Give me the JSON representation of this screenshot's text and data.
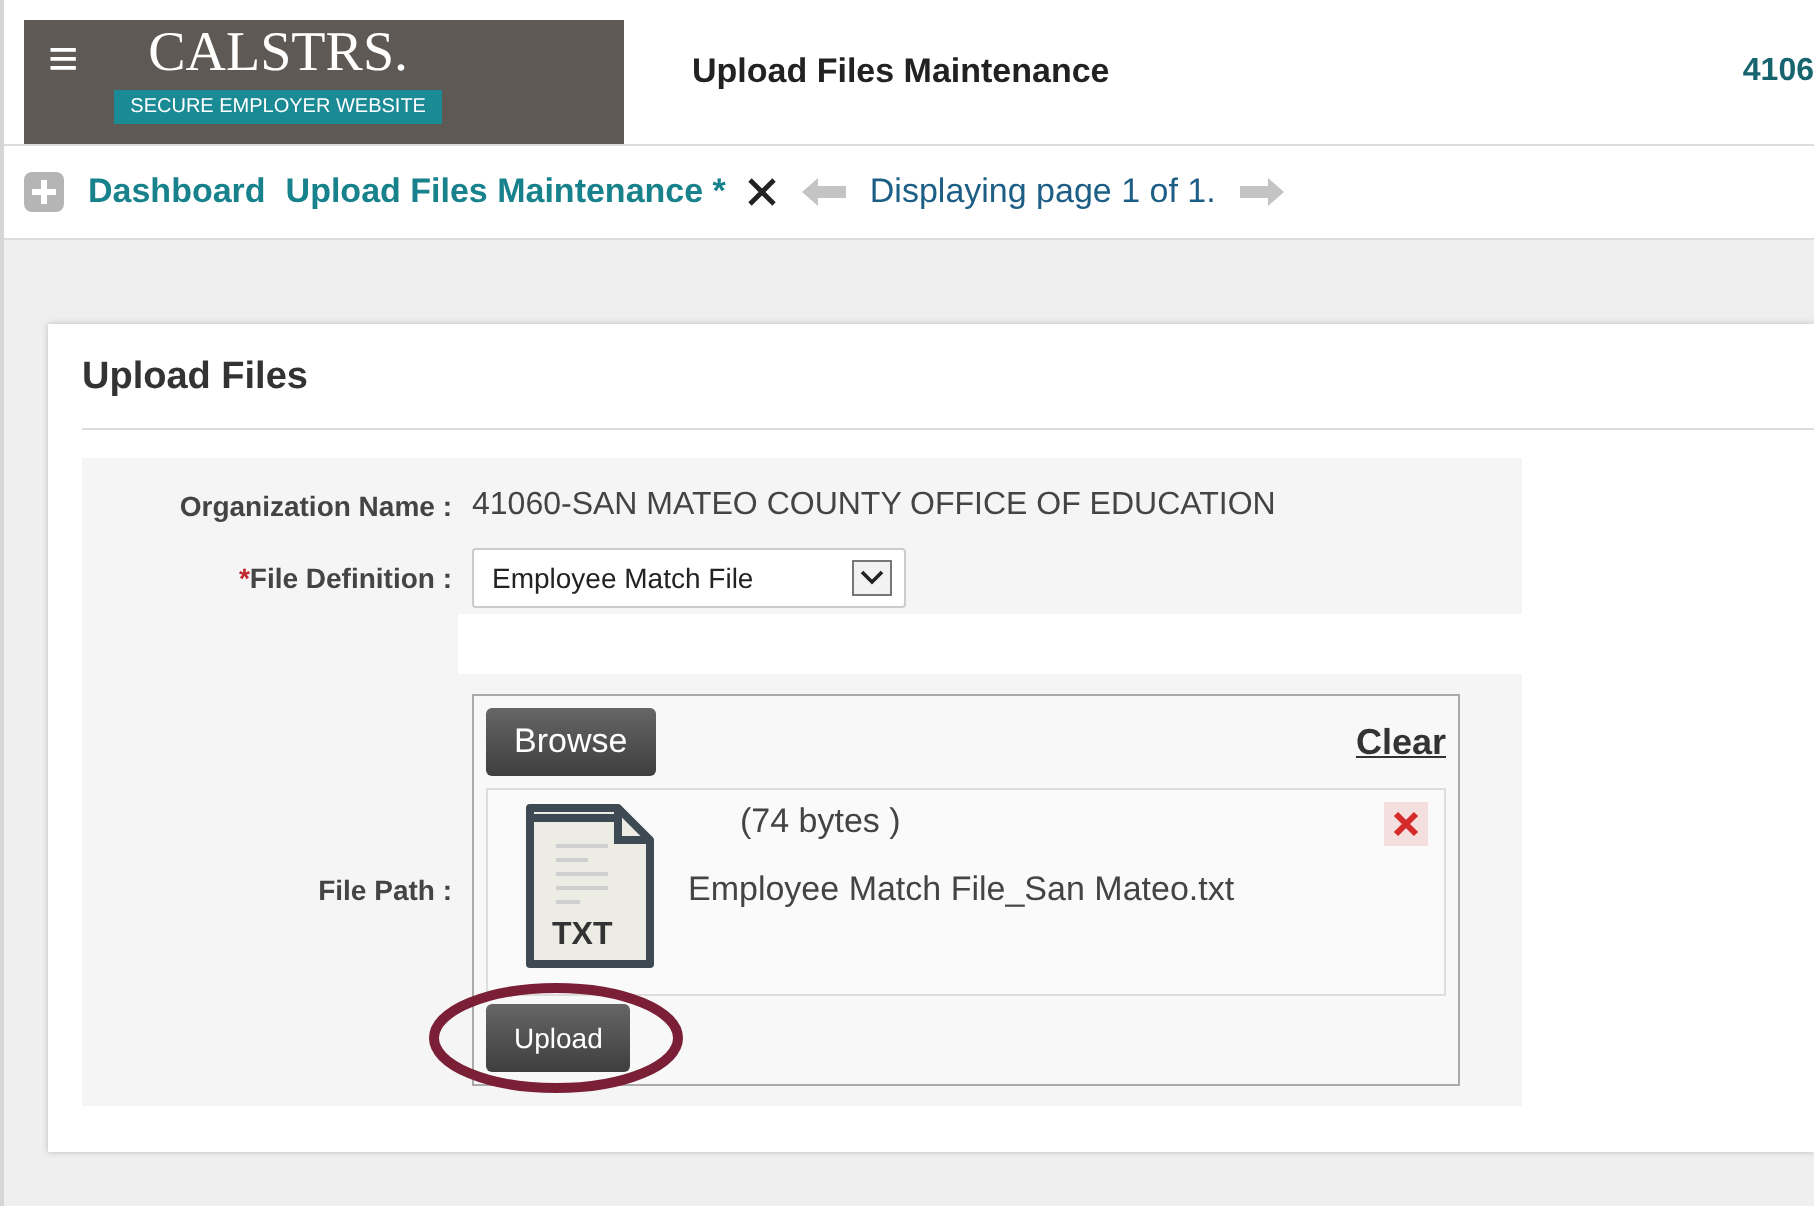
{
  "header": {
    "menu_glyph": "≡",
    "logo_text": "CALSTRS.",
    "logo_tagline": "SECURE EMPLOYER WEBSITE",
    "title": "Upload Files Maintenance",
    "org_code": "4106"
  },
  "breadcrumb": {
    "items": [
      {
        "label": "Dashboard"
      },
      {
        "label": "Upload Files Maintenance *"
      }
    ],
    "status": "Displaying page 1 of 1."
  },
  "panel": {
    "title": "Upload Files",
    "org_label": "Organization Name :",
    "org_value": "41060-SAN MATEO COUNTY OFFICE OF EDUCATION",
    "required_mark": "*",
    "def_label": "File Definition :",
    "def_value": "Employee Match File",
    "path_label": "File Path :",
    "browse": "Browse",
    "clear": "Clear",
    "file": {
      "type": "TXT",
      "size": "(74 bytes )",
      "name": "Employee Match File_San Mateo.txt"
    },
    "upload": "Upload",
    "upload_highlighted": true
  }
}
